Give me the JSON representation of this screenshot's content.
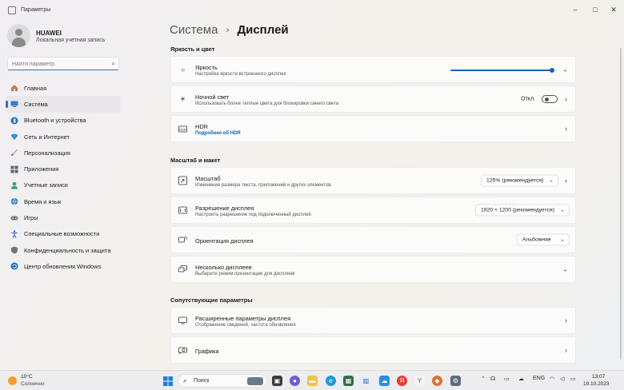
{
  "window": {
    "title": "Параметры",
    "controls": {
      "minimize": "–",
      "maximize": "□",
      "close": "✕"
    }
  },
  "profile": {
    "name": "HUAWEI",
    "account_type": "Локальная учетная запись"
  },
  "search": {
    "placeholder": "Найти параметр",
    "icon": "search-icon"
  },
  "sidebar": {
    "items": [
      {
        "label": "Главная",
        "icon": "home-icon",
        "color": "#c0784a"
      },
      {
        "label": "Система",
        "icon": "display-icon",
        "color": "#2f7bd3",
        "active": true
      },
      {
        "label": "Bluetooth и устройства",
        "icon": "bluetooth-icon",
        "color": "#1f73c8"
      },
      {
        "label": "Сеть и Интернет",
        "icon": "wifi-icon",
        "color": "#2d8fd8"
      },
      {
        "label": "Персонализация",
        "icon": "brush-icon",
        "color": "#d98a3a"
      },
      {
        "label": "Приложения",
        "icon": "apps-icon",
        "color": "#5b6770"
      },
      {
        "label": "Учетные записи",
        "icon": "person-icon",
        "color": "#2fa36b"
      },
      {
        "label": "Время и язык",
        "icon": "globe-icon",
        "color": "#2d7fd0"
      },
      {
        "label": "Игры",
        "icon": "gamepad-icon",
        "color": "#6b7680"
      },
      {
        "label": "Специальные возможности",
        "icon": "accessibility-icon",
        "color": "#1f6fc6"
      },
      {
        "label": "Конфиденциальность и защита",
        "icon": "shield-icon",
        "color": "#6b7680"
      },
      {
        "label": "Центр обновления Windows",
        "icon": "update-icon",
        "color": "#1f73c8"
      }
    ]
  },
  "breadcrumb": {
    "parent": "Система",
    "separator": "›",
    "current": "Дисплей"
  },
  "sections": {
    "brightness_color": {
      "title": "Яркость и цвет",
      "brightness": {
        "title": "Яркость",
        "subtitle": "Настройка яркости встроенного дисплея",
        "value_percent": 100
      },
      "night_light": {
        "title": "Ночной свет",
        "subtitle": "Использовать более теплые цвета для блокировки синего света",
        "state_label": "Откл."
      },
      "hdr": {
        "title": "HDR",
        "link": "Подробнее об HDR"
      }
    },
    "scale_layout": {
      "title": "Масштаб и макет",
      "scale": {
        "title": "Масштаб",
        "subtitle": "Изменение размера текста, приложений и других элементов",
        "value": "125% (рекомендуется)"
      },
      "resolution": {
        "title": "Разрешение дисплея",
        "subtitle": "Настроить разрешение под подключенный дисплей",
        "value": "1920 × 1200 (рекомендуется)"
      },
      "orientation": {
        "title": "Ориентация дисплея",
        "value": "Альбомная"
      },
      "multiple": {
        "title": "Несколько дисплеев",
        "subtitle": "Выберите режим презентации для дисплеев"
      }
    },
    "related": {
      "title": "Сопутствующие параметры",
      "advanced": {
        "title": "Расширенные параметры дисплея",
        "subtitle": "Отображение сведений, частота обновления"
      },
      "graphics": {
        "title": "Графика"
      }
    }
  },
  "taskbar": {
    "weather": {
      "temp": "10°C",
      "condition": "Солнечно"
    },
    "search_label": "Поиск",
    "tray": {
      "language": "ENG"
    },
    "clock": {
      "time": "13:07",
      "date": "19.10.2023"
    }
  },
  "colors": {
    "accent": "#1a5fb4",
    "active_indicator": "#2f6fd0"
  }
}
